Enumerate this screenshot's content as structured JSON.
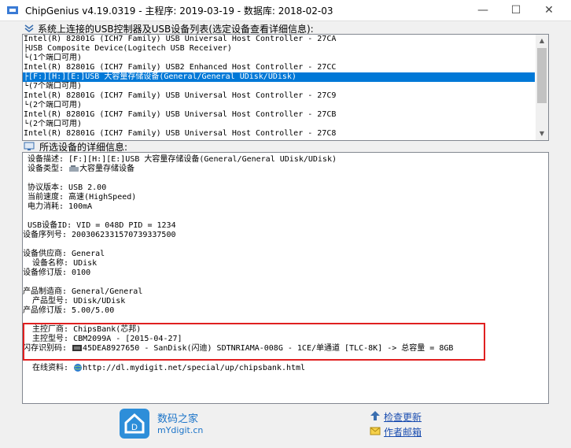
{
  "window": {
    "title": "ChipGenius v4.19.0319 - 主程序: 2019-03-19 - 数据库: 2018-02-03",
    "min_glyph": "—",
    "max_glyph": "☐",
    "close_glyph": "✕"
  },
  "device_list": {
    "label": "系统上连接的USB控制器及USB设备列表(选定设备查看详细信息):",
    "selected_index": 3,
    "rows": [
      "Intel(R) 82801G (ICH7 Family) USB Universal Host Controller - 27CA",
      "├USB Composite Device(Logitech USB Receiver)",
      "└(1个端口可用)",
      "Intel(R) 82801G (ICH7 Family) USB2 Enhanced Host Controller - 27CC",
      "├[F:][H:][E:]USB 大容量存储设备(General/General UDisk/UDisk)",
      "└(7个端口可用)",
      "Intel(R) 82801G (ICH7 Family) USB Universal Host Controller - 27C9",
      "└(2个端口可用)",
      "Intel(R) 82801G (ICH7 Family) USB Universal Host Controller - 27CB",
      "└(2个端口可用)",
      "Intel(R) 82801G (ICH7 Family) USB Universal Host Controller - 27C8"
    ]
  },
  "details": {
    "label": "所选设备的详细信息:",
    "lines": [
      {
        "text": " 设备描述: [F:][H:][E:]USB 大容量存储设备(General/General UDisk/UDisk)",
        "icon": ""
      },
      {
        "text": " 设备类型: ",
        "icon": "usb-drive-icon",
        "after": "大容量存储设备"
      },
      {
        "text": "",
        "icon": ""
      },
      {
        "text": " 协议版本: USB 2.00",
        "icon": ""
      },
      {
        "text": " 当前速度: 高速(HighSpeed)",
        "icon": ""
      },
      {
        "text": " 电力消耗: 100mA",
        "icon": ""
      },
      {
        "text": "",
        "icon": ""
      },
      {
        "text": " USB设备ID: VID = 048D PID = 1234",
        "icon": ""
      },
      {
        "text": "设备序列号: 2003062331570739337500",
        "icon": ""
      },
      {
        "text": "",
        "icon": ""
      },
      {
        "text": "设备供应商: General",
        "icon": ""
      },
      {
        "text": "  设备名称: UDisk",
        "icon": ""
      },
      {
        "text": "设备修订版: 0100",
        "icon": ""
      },
      {
        "text": "",
        "icon": ""
      },
      {
        "text": "产品制造商: General/General",
        "icon": ""
      },
      {
        "text": "  产品型号: UDisk/UDisk",
        "icon": ""
      },
      {
        "text": "产品修订版: 5.00/5.00",
        "icon": ""
      },
      {
        "text": "",
        "icon": ""
      },
      {
        "text": "  主控厂商: ChipsBank(芯邦)",
        "icon": ""
      },
      {
        "text": "  主控型号: CBM2099A - [2015-04-27]",
        "icon": ""
      },
      {
        "text": "闪存识别码: ",
        "icon": "chip-icon",
        "after": "45DEA8927650 - SanDisk(闪迪) SDTNRIAMA-008G - 1CE/单通道 [TLC-8K] -> 总容量 = 8GB"
      },
      {
        "text": "",
        "icon": ""
      },
      {
        "text": "  在线资料: ",
        "icon": "globe-icon",
        "after": "http://dl.mydigit.net/special/up/chipsbank.html"
      }
    ]
  },
  "footer": {
    "brand_cn": "数码之家",
    "brand_url": "mYdigit.cn",
    "check_update": "检查更新",
    "author_mail": "作者邮箱"
  }
}
